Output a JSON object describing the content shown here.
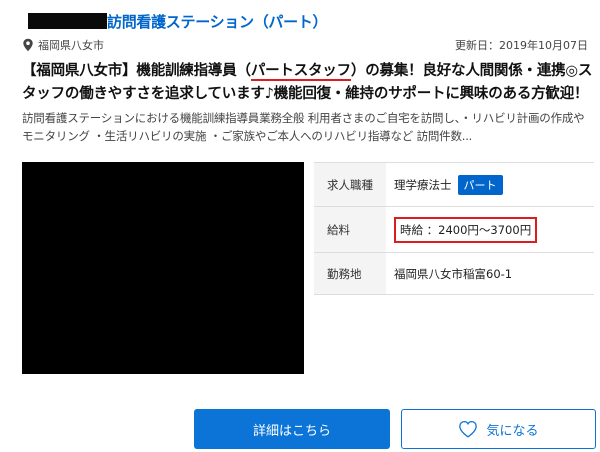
{
  "header": {
    "title": "訪問看護ステーション（パート）",
    "location": "福岡県八女市",
    "updated": "更新日：2019年10月07日"
  },
  "headline": {
    "part1": "【福岡県八女市】機能訓練指導員（",
    "highlight": "パートスタッフ",
    "part2": "）の募集！良好な人間関係・連携◎スタッフの働きやすさを追求しています♪機能回復・維持のサポートに興味のある方歓迎！"
  },
  "description": "訪問看護ステーションにおける機能訓練指導員業務全般 利用者さまのご自宅を訪問し、・リハビリ計画の作成やモニタリング ・生活リハビリの実施 ・ご家族やご本人へのリハビリ指導など 訪問件数...",
  "info": {
    "job_label": "求人職種",
    "job_value": "理学療法士",
    "job_badge": "パート",
    "salary_label": "給料",
    "salary_value": "時給 ：2400円～3700円",
    "location_label": "勤務地",
    "location_value": "福岡県八女市稲富60-1"
  },
  "buttons": {
    "detail": "詳細はこちら",
    "favorite": "気になる"
  },
  "colors": {
    "link": "#0066cc",
    "button": "#0b74d6",
    "highlight_red": "#d81e1e"
  }
}
